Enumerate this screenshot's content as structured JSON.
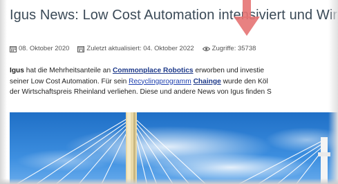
{
  "article": {
    "title": "Igus News: Low Cost Automation intensiviert und Wirtschaf",
    "meta": {
      "published": "08. Oktober 2020",
      "updated": "Zuletzt aktualisiert: 04. Oktober 2022",
      "views": "Zugriffe: 35738"
    },
    "paragraph": {
      "l1_a": "Igus",
      "l1_b": " hat die Mehrheitsanteile an ",
      "l1_c": "Commonplace Robotics",
      "l1_d": " erworben und investie",
      "l2_a": "seiner Low Cost Automation. Für sein ",
      "l2_b": "Recyclingprogramm",
      "l2_c": " ",
      "l2_d": "Chainge",
      "l2_e": " wurde den Köl",
      "l3": "der Wirtschaftspreis Rheinland verliehen. Diese und andere News von Igus finden S"
    }
  },
  "colors": {
    "title": "#3b4a57",
    "link": "#1e40af",
    "arrow": "#e57373",
    "sky": "#2f7fd0"
  },
  "icons": {
    "published": "calendar-icon",
    "updated": "calendar-edit-icon",
    "views": "eye-icon",
    "annotation": "arrow-down-icon"
  }
}
